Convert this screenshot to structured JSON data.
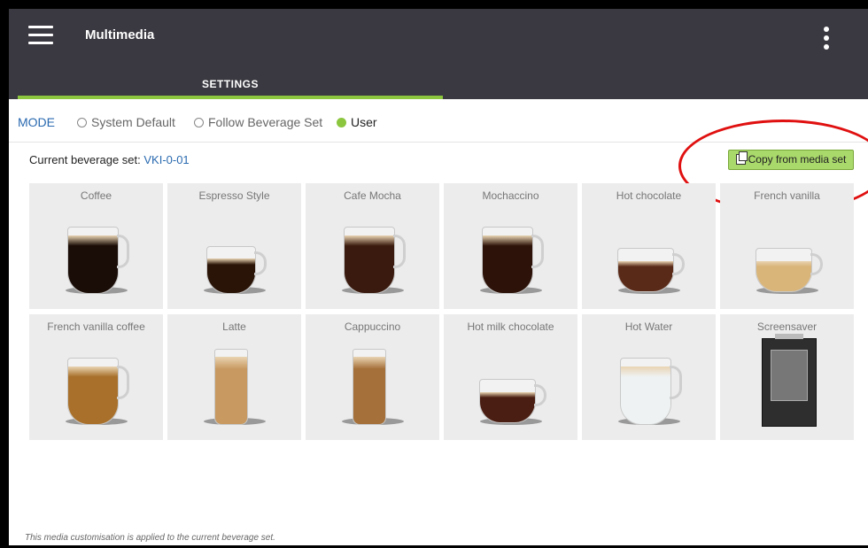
{
  "appbar": {
    "title": "Multimedia",
    "tab": "SETTINGS"
  },
  "mode": {
    "label": "MODE",
    "options": [
      {
        "label": "System Default",
        "checked": false
      },
      {
        "label": "Follow Beverage Set",
        "checked": false
      },
      {
        "label": "User",
        "checked": true
      }
    ]
  },
  "beverage_set": {
    "label": "Current beverage set: ",
    "value": "VKI-0-01"
  },
  "copy_button": "Copy from media set",
  "tiles": [
    {
      "label": "Coffee",
      "color": "#1a0c06"
    },
    {
      "label": "Espresso Style",
      "color": "#2a1408"
    },
    {
      "label": "Cafe Mocha",
      "color": "#3a1a0e"
    },
    {
      "label": "Mochaccino",
      "color": "#2c1208"
    },
    {
      "label": "Hot chocolate",
      "color": "#5a2a18"
    },
    {
      "label": "French vanilla",
      "color": "#d9b57a"
    },
    {
      "label": "French vanilla coffee",
      "color": "#a8702a"
    },
    {
      "label": "Latte",
      "color": "#c89a62"
    },
    {
      "label": "Cappuccino",
      "color": "#a5703a"
    },
    {
      "label": "Hot milk chocolate",
      "color": "#4a1e12"
    },
    {
      "label": "Hot Water",
      "color": "#eef2f2"
    },
    {
      "label": "Screensaver",
      "color": "#2e2e2e"
    }
  ],
  "footnote": "This media customisation is applied to the current beverage set.",
  "colors": {
    "accent": "#8cc63f",
    "appbar": "#3a3840",
    "link": "#2a6ab0",
    "highlight": "#e01010"
  }
}
